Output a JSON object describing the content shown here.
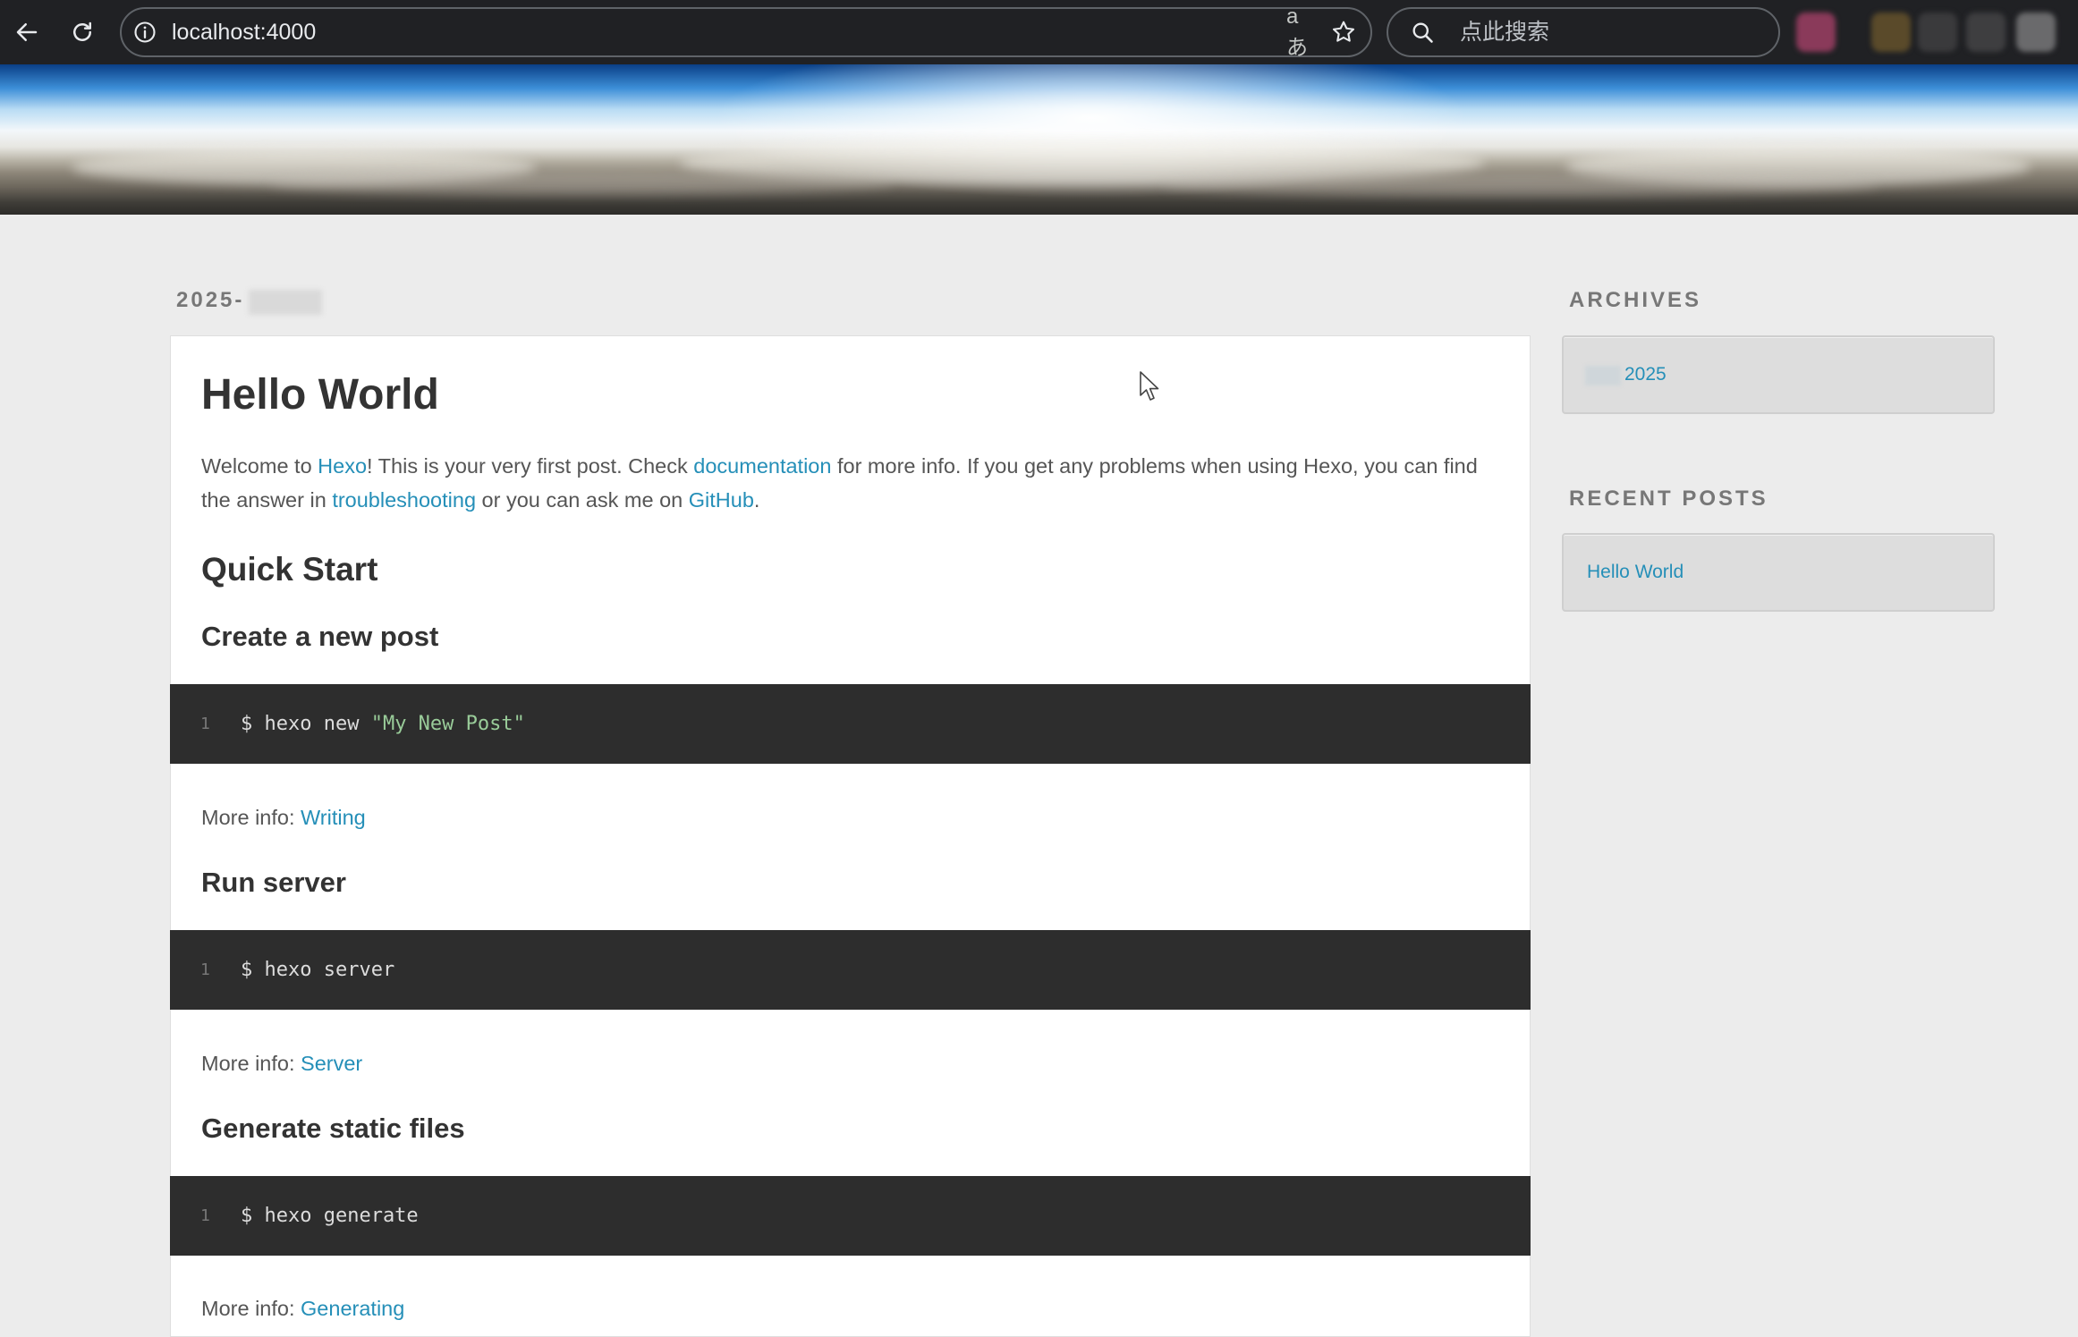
{
  "browser": {
    "url": "localhost:4000",
    "translate_label": "aあ",
    "search_placeholder": "点此搜索"
  },
  "post": {
    "date": "2025-",
    "title": "Hello World",
    "intro": {
      "p1": "Welcome to ",
      "hexo_link": "Hexo",
      "p2": "! This is your very first post. Check ",
      "documentation_link": "documentation",
      "p3": " for more info. If you get any problems when using Hexo, you can find the answer in ",
      "troubleshooting_link": "troubleshooting",
      "p4": " or you can ask me on ",
      "github_link": "GitHub",
      "p5": "."
    },
    "quick_start_heading": "Quick Start",
    "sections": [
      {
        "heading": "Create a new post",
        "line_number": "1",
        "code_command": "$ hexo new ",
        "code_string": "\"My New Post\"",
        "more_info_label": "More info: ",
        "more_info_link": "Writing"
      },
      {
        "heading": "Run server",
        "line_number": "1",
        "code_command": "$ hexo server",
        "code_string": "",
        "more_info_label": "More info: ",
        "more_info_link": "Server"
      },
      {
        "heading": "Generate static files",
        "line_number": "1",
        "code_command": "$ hexo generate",
        "code_string": "",
        "more_info_label": "More info: ",
        "more_info_link": "Generating"
      }
    ]
  },
  "sidebar": {
    "archives_heading": "ARCHIVES",
    "archive_year": "2025",
    "recent_posts_heading": "RECENT POSTS",
    "recent_post": "Hello World"
  },
  "colors": {
    "link": "#258fb8",
    "code_background": "#2d2d2d",
    "code_string": "#99cc99",
    "page_background": "#ececec"
  }
}
